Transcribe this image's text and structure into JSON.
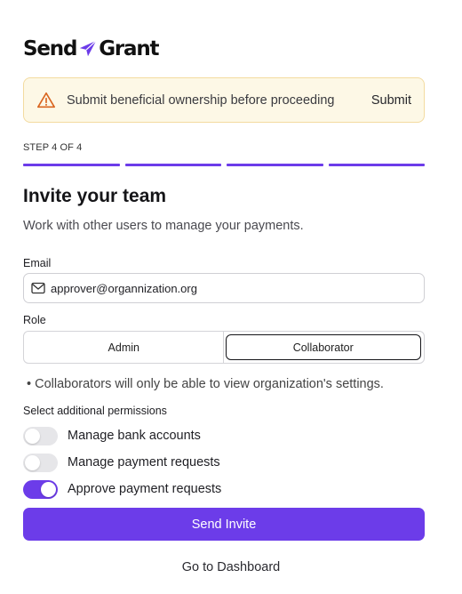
{
  "brand": {
    "part1": "Send",
    "part2": "Grant",
    "accent": "#6c3ce9"
  },
  "alert": {
    "message": "Submit beneficial ownership before proceeding",
    "action": "Submit"
  },
  "steps": {
    "label": "STEP 4 OF 4",
    "total": 4,
    "completed": 4
  },
  "heading": {
    "title": "Invite your team",
    "subtitle": "Work with other users to manage your payments."
  },
  "email": {
    "label": "Email",
    "value": "approver@organnization.org",
    "icon": "mail-icon"
  },
  "role": {
    "label": "Role",
    "options": [
      "Admin",
      "Collaborator"
    ],
    "selected": "Collaborator"
  },
  "role_note": "• Collaborators will only be able to view organization's settings.",
  "permissions": {
    "label": "Select additional permissions",
    "items": [
      {
        "label": "Manage bank accounts",
        "enabled": false
      },
      {
        "label": "Manage payment requests",
        "enabled": false
      },
      {
        "label": "Approve payment requests",
        "enabled": true
      }
    ]
  },
  "actions": {
    "send": "Send Invite",
    "dashboard": "Go to Dashboard"
  }
}
